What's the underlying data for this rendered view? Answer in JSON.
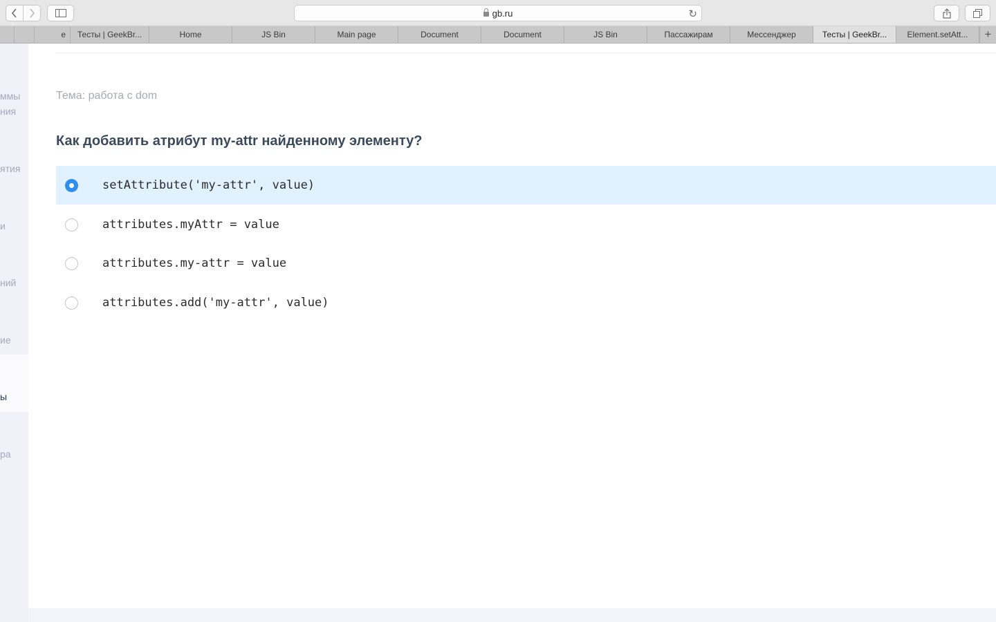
{
  "browser": {
    "url": "gb.ru",
    "icons": {
      "back": "chevron-left-icon",
      "forward": "chevron-right-icon",
      "sidebar": "sidebar-icon",
      "lock": "lock-icon",
      "reload": "reload-icon",
      "share": "share-icon",
      "tabs": "tabs-overview-icon",
      "new_tab": "plus-icon"
    },
    "tabs": [
      {
        "label": "е"
      },
      {
        "label": "Тесты | GeekBr..."
      },
      {
        "label": "Home"
      },
      {
        "label": "JS Bin"
      },
      {
        "label": "Main page"
      },
      {
        "label": "Document"
      },
      {
        "label": "Document"
      },
      {
        "label": "JS Bin"
      },
      {
        "label": "Пассажирам"
      },
      {
        "label": "Мессенджер"
      },
      {
        "label": "Тесты | GeekBr..."
      },
      {
        "label": "Element.setAtt..."
      }
    ],
    "active_tab_index": 10,
    "new_tab_label": "+"
  },
  "nav": {
    "items": [
      {
        "label": "ммы"
      },
      {
        "label": "ния"
      },
      {
        "label": "ятия"
      },
      {
        "label": "и"
      },
      {
        "label": "ний"
      },
      {
        "label": "ие"
      },
      {
        "label": "ы"
      },
      {
        "label": "ра"
      }
    ]
  },
  "quiz": {
    "topic": "Тема: работа с dom",
    "question": "Как добавить атрибут my-attr найденному элементу?",
    "options": [
      {
        "label": "setAttribute('my-attr', value)",
        "selected": true
      },
      {
        "label": "attributes.myAttr = value",
        "selected": false
      },
      {
        "label": "attributes.my-attr = value",
        "selected": false
      },
      {
        "label": "attributes.add('my-attr', value)",
        "selected": false
      }
    ]
  },
  "colors": {
    "accent": "#2d8ef0",
    "selected_bg": "#e1f1fd",
    "question_text": "#3a4a5c",
    "nav_bg": "#f1f1fa"
  }
}
